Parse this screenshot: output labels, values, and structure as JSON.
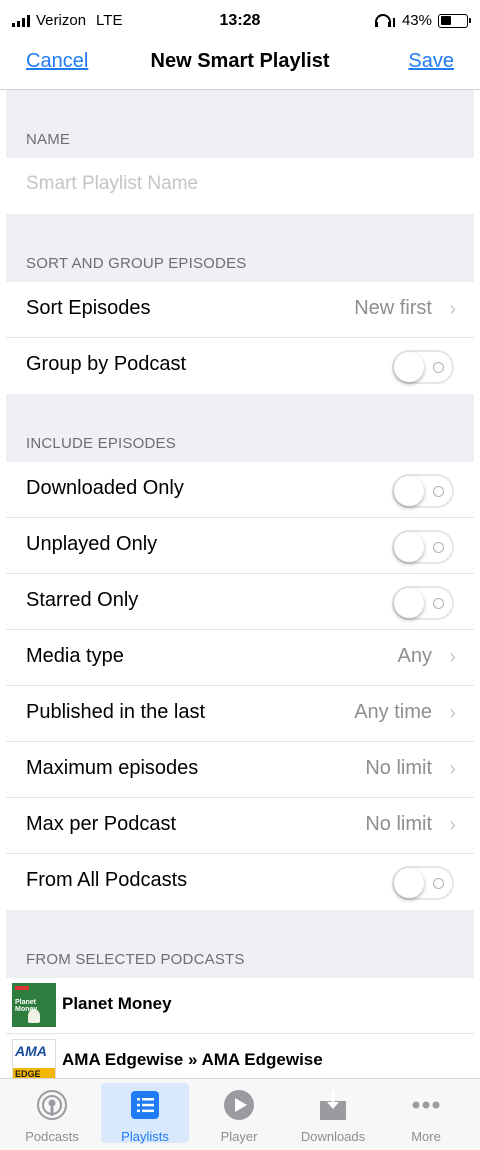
{
  "status_bar": {
    "carrier": "Verizon",
    "network": "LTE",
    "time": "13:28",
    "battery": "43%",
    "battery_level": 0.43
  },
  "nav": {
    "cancel": "Cancel",
    "title": "New Smart Playlist",
    "save": "Save"
  },
  "name_section": {
    "header": "NAME",
    "placeholder": "Smart Playlist Name"
  },
  "sort_section": {
    "header": "SORT AND GROUP EPISODES",
    "sort_label": "Sort Episodes",
    "sort_value": "New first",
    "group_label": "Group by Podcast",
    "group_on": false
  },
  "include_section": {
    "header": "INCLUDE EPISODES",
    "downloaded_label": "Downloaded Only",
    "unplayed_label": "Unplayed Only",
    "starred_label": "Starred Only",
    "media_label": "Media type",
    "media_value": "Any",
    "published_label": "Published in the last",
    "published_value": "Any time",
    "max_label": "Maximum episodes",
    "max_value": "No limit",
    "maxper_label": "Max per Podcast",
    "maxper_value": "No limit",
    "fromall_label": "From All Podcasts"
  },
  "selected_section": {
    "header": "FROM SELECTED PODCASTS",
    "podcasts": [
      {
        "title": "Planet Money",
        "art_text": "Planet Money"
      },
      {
        "title": "AMA Edgewise » AMA Edgewise",
        "art_text": "AMA",
        "art_band": "EDGE"
      }
    ]
  },
  "tabs": [
    {
      "label": "Podcasts",
      "icon": "podcast-icon"
    },
    {
      "label": "Playlists",
      "icon": "list-icon",
      "active": true
    },
    {
      "label": "Player",
      "icon": "play-icon"
    },
    {
      "label": "Downloads",
      "icon": "download-icon"
    },
    {
      "label": "More",
      "icon": "more-icon"
    }
  ],
  "colors": {
    "accent": "#1f7bf6",
    "group_bg": "#efeff4",
    "secondary_text": "#8e8e93"
  }
}
